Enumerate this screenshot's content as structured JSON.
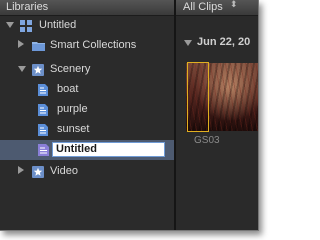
{
  "library_pane": {
    "header": "Libraries",
    "items": [
      {
        "label": "Untitled",
        "icon": "library-grid-icon",
        "expanded": true
      },
      {
        "label": "Smart Collections",
        "icon": "folder-icon",
        "expanded": false
      },
      {
        "label": "Scenery",
        "icon": "event-star-icon",
        "expanded": true
      },
      {
        "label": "boat",
        "icon": "keyword-collection-icon"
      },
      {
        "label": "purple",
        "icon": "keyword-collection-icon"
      },
      {
        "label": "sunset",
        "icon": "keyword-collection-icon"
      },
      {
        "label": "Untitled",
        "icon": "smart-collection-icon",
        "editing": true
      },
      {
        "label": "Video",
        "icon": "event-star-icon",
        "expanded": false
      }
    ]
  },
  "browser": {
    "filter": "All Clips",
    "filter_arrows": "⬍",
    "date_group": "Jun 22, 20",
    "clip_name": "GS03"
  },
  "colors": {
    "selection_row": "#4d5a70",
    "edit_border": "#6f9bd6",
    "clip_selection": "#e0b020",
    "icon_blue": "#5b8ed8"
  }
}
